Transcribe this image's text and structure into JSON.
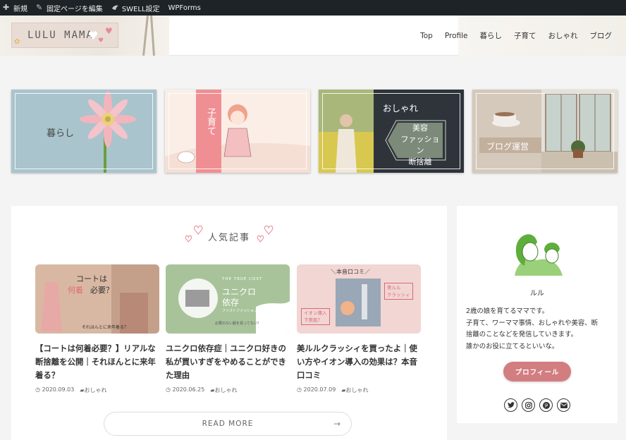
{
  "adminbar": {
    "items": [
      {
        "label": "新規",
        "icon": "plus-icon"
      },
      {
        "label": "固定ページを編集",
        "icon": "pencil-icon"
      },
      {
        "label": "SWELL設定",
        "icon": "swell-bird-icon"
      },
      {
        "label": "WPForms",
        "icon": ""
      }
    ]
  },
  "header": {
    "logo_text": "LULU MAMA",
    "nav": [
      "Top",
      "Profile",
      "暮らし",
      "子育て",
      "おしゃれ",
      "ブログ"
    ]
  },
  "banners": [
    {
      "label": "暮らし"
    },
    {
      "label": "子育て"
    },
    {
      "label": "おしゃれ",
      "sub": [
        "美容",
        "ファッション",
        "断捨離"
      ]
    },
    {
      "label": "ブログ運営"
    }
  ],
  "popular": {
    "title": "人気記事",
    "cards": [
      {
        "title": "【コートは何着必要？】リアルな断捨離を公開｜それほんとに来年着る？",
        "date": "2020.09.03",
        "category": "おしゃれ",
        "thumb_text": [
          "コートは",
          "何着",
          "必要？",
          "それほんとに来年着る？"
        ]
      },
      {
        "title": "ユニクロ依存症｜ユニクロ好きの私が買いすぎをやめることができた理由",
        "date": "2020.06.25",
        "category": "おしゃれ",
        "thumb_text": [
          "THE TRUE COST",
          "ユニクロ",
          "依存",
          "ファストファッションの代償",
          "必要のない服を買ってない？"
        ]
      },
      {
        "title": "美ルルクラッシィを買ったよ｜使い方やイオン導入の効果は？本音口コミ",
        "date": "2020.07.09",
        "category": "おしゃれ",
        "thumb_text": [
          "＼本音口コミ／",
          "美ルル",
          "クラッシィ",
          "イオン導入",
          "下美肌？"
        ]
      }
    ],
    "read_more": "READ MORE"
  },
  "profile": {
    "name": "ルル",
    "description": "2歳の娘を育てるママです。\n子育て、ワーママ事情、おしゃれや美容、断捨離のことなどを発信していきます。\n誰かのお役に立てるといいな。",
    "description_lines": [
      "2歳の娘を育てるママです。",
      "子育て、ワーママ事情、おしゃれや美容、断",
      "捨離のことなどを発信していきます。",
      "誰かのお役に立てるといいな。"
    ],
    "button": "プロフィール",
    "socials": [
      "twitter-icon",
      "instagram-icon",
      "pinterest-icon",
      "mail-icon"
    ]
  },
  "colors": {
    "adminbar": "#1d2327",
    "accent": "#d27d80",
    "heart": "#e58c9a"
  }
}
